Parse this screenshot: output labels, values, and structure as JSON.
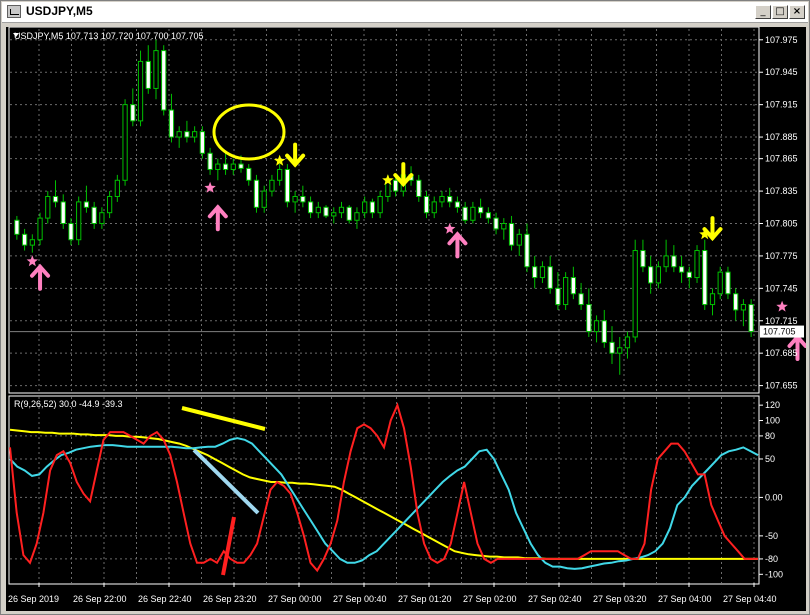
{
  "window": {
    "title": "USDJPY,M5",
    "buttons": [
      "_",
      "□",
      "×"
    ]
  },
  "price_chart": {
    "info_label": "USDJPY,M5  107.713 107.720 107.700 107.705",
    "y_ticks": [
      "107.975",
      "107.945",
      "107.915",
      "107.885",
      "107.865",
      "107.835",
      "107.805",
      "107.775",
      "107.745",
      "107.715",
      "107.685",
      "107.655"
    ],
    "y_tick_values": [
      107.975,
      107.945,
      107.915,
      107.885,
      107.865,
      107.835,
      107.805,
      107.775,
      107.745,
      107.715,
      107.685,
      107.655
    ],
    "y_range": [
      107.65,
      107.985
    ],
    "current_price": "107.705",
    "current_price_value": 107.705,
    "candle_color_up": "#00c000",
    "candle_color_down": "#ffffff",
    "shadow_color": "#00c000"
  },
  "indicator": {
    "label": "R(9,26,52) 30.0 -44.9 -39.3",
    "y_ticks": [
      "120",
      "100",
      "80",
      "50",
      "0.00",
      "-50",
      "-80",
      "-100"
    ],
    "y_tick_values": [
      120,
      100,
      80,
      50,
      0,
      -50,
      -80,
      -100
    ],
    "y_range": [
      -110,
      128
    ],
    "series_colors": {
      "fast": "#ff2020",
      "mid": "#40d8e8",
      "slow": "#ffff00"
    }
  },
  "x_axis": {
    "labels": [
      "26 Sep 2019",
      "26 Sep 22:00",
      "26 Sep 22:40",
      "26 Sep 23:20",
      "27 Sep 00:00",
      "27 Sep 00:40",
      "27 Sep 01:20",
      "27 Sep 02:00",
      "27 Sep 02:40",
      "27 Sep 03:20",
      "27 Sep 04:00",
      "27 Sep 04:40"
    ]
  },
  "chart_data": {
    "type": "candlestick",
    "candles": [
      [
        107.808,
        107.812,
        107.79,
        107.795
      ],
      [
        107.795,
        107.8,
        107.78,
        107.785
      ],
      [
        107.785,
        107.795,
        107.778,
        107.79
      ],
      [
        107.79,
        107.815,
        107.785,
        107.81
      ],
      [
        107.81,
        107.835,
        107.805,
        107.83
      ],
      [
        107.83,
        107.845,
        107.82,
        107.825
      ],
      [
        107.825,
        107.832,
        107.8,
        107.805
      ],
      [
        107.805,
        107.81,
        107.785,
        107.79
      ],
      [
        107.79,
        107.83,
        107.785,
        107.825
      ],
      [
        107.825,
        107.84,
        107.815,
        107.82
      ],
      [
        107.82,
        107.825,
        107.8,
        107.805
      ],
      [
        107.805,
        107.82,
        107.8,
        107.815
      ],
      [
        107.815,
        107.835,
        107.81,
        107.83
      ],
      [
        107.83,
        107.85,
        107.825,
        107.845
      ],
      [
        107.845,
        107.92,
        107.84,
        107.915
      ],
      [
        107.915,
        107.93,
        107.895,
        107.9
      ],
      [
        107.9,
        107.965,
        107.895,
        107.955
      ],
      [
        107.955,
        107.97,
        107.925,
        107.93
      ],
      [
        107.93,
        107.975,
        107.92,
        107.965
      ],
      [
        107.965,
        107.97,
        107.905,
        107.91
      ],
      [
        107.91,
        107.925,
        107.88,
        107.885
      ],
      [
        107.885,
        107.895,
        107.875,
        107.89
      ],
      [
        107.89,
        107.9,
        107.88,
        107.885
      ],
      [
        107.885,
        107.895,
        107.88,
        107.89
      ],
      [
        107.89,
        107.895,
        107.865,
        107.87
      ],
      [
        107.87,
        107.875,
        107.85,
        107.855
      ],
      [
        107.855,
        107.865,
        107.845,
        107.86
      ],
      [
        107.86,
        107.87,
        107.85,
        107.855
      ],
      [
        107.855,
        107.865,
        107.85,
        107.86
      ],
      [
        107.86,
        107.868,
        107.852,
        107.856
      ],
      [
        107.856,
        107.86,
        107.84,
        107.845
      ],
      [
        107.845,
        107.85,
        107.815,
        107.82
      ],
      [
        107.82,
        107.84,
        107.815,
        107.835
      ],
      [
        107.835,
        107.85,
        107.83,
        107.845
      ],
      [
        107.845,
        107.86,
        107.84,
        107.855
      ],
      [
        107.855,
        107.86,
        107.82,
        107.825
      ],
      [
        107.825,
        107.835,
        107.815,
        107.83
      ],
      [
        107.83,
        107.84,
        107.82,
        107.825
      ],
      [
        107.825,
        107.83,
        107.81,
        107.815
      ],
      [
        107.815,
        107.825,
        107.81,
        107.82
      ],
      [
        107.82,
        107.822,
        107.81,
        107.812
      ],
      [
        107.812,
        107.82,
        107.805,
        107.815
      ],
      [
        107.815,
        107.825,
        107.81,
        107.82
      ],
      [
        107.82,
        107.822,
        107.805,
        107.808
      ],
      [
        107.808,
        107.82,
        107.8,
        107.815
      ],
      [
        107.815,
        107.83,
        107.81,
        107.825
      ],
      [
        107.825,
        107.828,
        107.81,
        107.815
      ],
      [
        107.815,
        107.835,
        107.81,
        107.83
      ],
      [
        107.83,
        107.85,
        107.825,
        107.845
      ],
      [
        107.845,
        107.85,
        107.83,
        107.835
      ],
      [
        107.835,
        107.855,
        107.83,
        107.85
      ],
      [
        107.85,
        107.858,
        107.84,
        107.845
      ],
      [
        107.845,
        107.85,
        107.825,
        107.83
      ],
      [
        107.83,
        107.835,
        107.81,
        107.815
      ],
      [
        107.815,
        107.83,
        107.81,
        107.825
      ],
      [
        107.825,
        107.835,
        107.82,
        107.83
      ],
      [
        107.83,
        107.838,
        107.82,
        107.825
      ],
      [
        107.825,
        107.83,
        107.815,
        107.82
      ],
      [
        107.82,
        107.825,
        107.805,
        107.808
      ],
      [
        107.808,
        107.825,
        107.805,
        107.82
      ],
      [
        107.82,
        107.828,
        107.81,
        107.815
      ],
      [
        107.815,
        107.82,
        107.805,
        107.81
      ],
      [
        107.81,
        107.815,
        107.795,
        107.8
      ],
      [
        107.8,
        107.81,
        107.79,
        107.805
      ],
      [
        107.805,
        107.812,
        107.78,
        107.785
      ],
      [
        107.785,
        107.8,
        107.775,
        107.795
      ],
      [
        107.795,
        107.805,
        107.76,
        107.765
      ],
      [
        107.765,
        107.775,
        107.745,
        107.755
      ],
      [
        107.755,
        107.77,
        107.75,
        107.765
      ],
      [
        107.765,
        107.775,
        107.74,
        107.745
      ],
      [
        107.745,
        107.76,
        107.725,
        107.73
      ],
      [
        107.73,
        107.76,
        107.725,
        107.755
      ],
      [
        107.755,
        107.765,
        107.735,
        107.74
      ],
      [
        107.74,
        107.75,
        107.725,
        107.73
      ],
      [
        107.73,
        107.745,
        107.7,
        107.705
      ],
      [
        107.705,
        107.72,
        107.695,
        107.715
      ],
      [
        107.715,
        107.725,
        107.69,
        107.695
      ],
      [
        107.695,
        107.71,
        107.675,
        107.685
      ],
      [
        107.685,
        107.7,
        107.665,
        107.69
      ],
      [
        107.69,
        107.705,
        107.68,
        107.7
      ],
      [
        107.7,
        107.79,
        107.695,
        107.78
      ],
      [
        107.78,
        107.79,
        107.76,
        107.765
      ],
      [
        107.765,
        107.775,
        107.74,
        107.75
      ],
      [
        107.75,
        107.77,
        107.745,
        107.765
      ],
      [
        107.765,
        107.79,
        107.76,
        107.775
      ],
      [
        107.775,
        107.785,
        107.76,
        107.765
      ],
      [
        107.765,
        107.775,
        107.75,
        107.76
      ],
      [
        107.76,
        107.765,
        107.745,
        107.755
      ],
      [
        107.755,
        107.785,
        107.75,
        107.78
      ],
      [
        107.78,
        107.79,
        107.725,
        107.73
      ],
      [
        107.73,
        107.745,
        107.72,
        107.74
      ],
      [
        107.74,
        107.765,
        107.735,
        107.76
      ],
      [
        107.76,
        107.765,
        107.735,
        107.74
      ],
      [
        107.74,
        107.745,
        107.715,
        107.725
      ],
      [
        107.725,
        107.735,
        107.71,
        107.73
      ],
      [
        107.73,
        107.735,
        107.7,
        107.705
      ]
    ],
    "signals": [
      {
        "type": "star",
        "color": "#ff80c0",
        "index": 2,
        "price": 107.77
      },
      {
        "type": "arrow-up",
        "color": "#ff80c0",
        "index": 3,
        "price": 107.765
      },
      {
        "type": "star",
        "color": "#ff80c0",
        "index": 25,
        "price": 107.838
      },
      {
        "type": "arrow-up",
        "color": "#ff80c0",
        "index": 26,
        "price": 107.82
      },
      {
        "type": "star",
        "color": "#ffff00",
        "index": 34,
        "price": 107.863
      },
      {
        "type": "arrow-down",
        "color": "#ffff00",
        "index": 36,
        "price": 107.878
      },
      {
        "type": "star",
        "color": "#ffff00",
        "index": 48,
        "price": 107.845
      },
      {
        "type": "arrow-down",
        "color": "#ffff00",
        "index": 50,
        "price": 107.86
      },
      {
        "type": "star",
        "color": "#ff80c0",
        "index": 56,
        "price": 107.8
      },
      {
        "type": "arrow-up",
        "color": "#ff80c0",
        "index": 57,
        "price": 107.795
      },
      {
        "type": "star",
        "color": "#ffff00",
        "index": 89,
        "price": 107.795
      },
      {
        "type": "arrow-down",
        "color": "#ffff00",
        "index": 90,
        "price": 107.81
      },
      {
        "type": "star",
        "color": "#ff80c0",
        "index": 99,
        "price": 107.728
      },
      {
        "type": "arrow-up",
        "color": "#ff80c0",
        "index": 101,
        "price": 107.7
      }
    ],
    "indicator_series": {
      "fast": [
        65,
        -20,
        -75,
        -85,
        -60,
        -20,
        35,
        55,
        60,
        45,
        20,
        5,
        -5,
        35,
        75,
        85,
        85,
        85,
        80,
        75,
        70,
        80,
        85,
        75,
        55,
        20,
        -20,
        -60,
        -85,
        -85,
        -80,
        -85,
        -70,
        -80,
        -85,
        -85,
        -75,
        -60,
        -25,
        10,
        20,
        15,
        5,
        -20,
        -50,
        -85,
        -95,
        -80,
        -60,
        -30,
        20,
        60,
        90,
        95,
        90,
        80,
        65,
        100,
        120,
        90,
        40,
        -20,
        -60,
        -80,
        -85,
        -80,
        -60,
        -20,
        20,
        -20,
        -60,
        -80,
        -85,
        -80,
        -80,
        -80,
        -80,
        -80,
        -80,
        -80,
        -80,
        -80,
        -80,
        -80,
        -80,
        -80,
        -75,
        -70,
        -70,
        -70,
        -70,
        -70,
        -75,
        -80,
        -80,
        -60,
        10,
        50,
        60,
        70,
        70,
        60,
        45,
        30,
        30,
        -10,
        -30,
        -50,
        -60,
        -70,
        -80,
        -80,
        -80
      ],
      "mid": [
        50,
        40,
        35,
        28,
        30,
        40,
        48,
        55,
        58,
        62,
        64,
        66,
        67,
        68,
        68,
        67,
        66,
        66,
        66,
        66,
        66,
        66,
        66,
        65,
        64,
        64,
        65,
        66,
        66,
        70,
        75,
        77,
        75,
        70,
        60,
        50,
        40,
        30,
        15,
        0,
        -15,
        -30,
        -45,
        -60,
        -70,
        -80,
        -85,
        -85,
        -82,
        -75,
        -70,
        -60,
        -50,
        -40,
        -30,
        -20,
        -10,
        0,
        10,
        20,
        28,
        35,
        40,
        50,
        60,
        62,
        50,
        30,
        10,
        -20,
        -40,
        -60,
        -75,
        -85,
        -90,
        -90,
        -92,
        -93,
        -92,
        -90,
        -88,
        -86,
        -85,
        -83,
        -82,
        -80,
        -78,
        -75,
        -70,
        -60,
        -40,
        -10,
        0,
        15,
        25,
        35,
        45,
        55,
        60,
        62,
        65,
        60,
        55
      ],
      "slow": [
        88,
        87,
        86,
        85,
        85,
        84,
        84,
        83,
        83,
        83,
        82,
        82,
        81,
        81,
        81,
        80,
        80,
        79,
        79,
        78,
        77,
        76,
        74,
        72,
        70,
        67,
        63,
        59,
        55,
        50,
        45,
        40,
        35,
        30,
        26,
        24,
        22,
        20,
        20,
        19,
        19,
        18,
        18,
        17,
        16,
        15,
        14,
        10,
        5,
        0,
        -5,
        -10,
        -15,
        -20,
        -25,
        -30,
        -35,
        -40,
        -45,
        -50,
        -55,
        -60,
        -65,
        -70,
        -72,
        -74,
        -75,
        -76,
        -77,
        -77,
        -78,
        -78,
        -78,
        -79,
        -79,
        -79,
        -80,
        -80,
        -80,
        -80,
        -80,
        -80,
        -80,
        -80,
        -80,
        -80,
        -80,
        -80,
        -80,
        -80,
        -80,
        -80,
        -80,
        -80,
        -80,
        -80,
        -80,
        -80,
        -80,
        -80,
        -80,
        -80,
        -80,
        -80,
        -80,
        -80,
        -80
      ]
    }
  }
}
